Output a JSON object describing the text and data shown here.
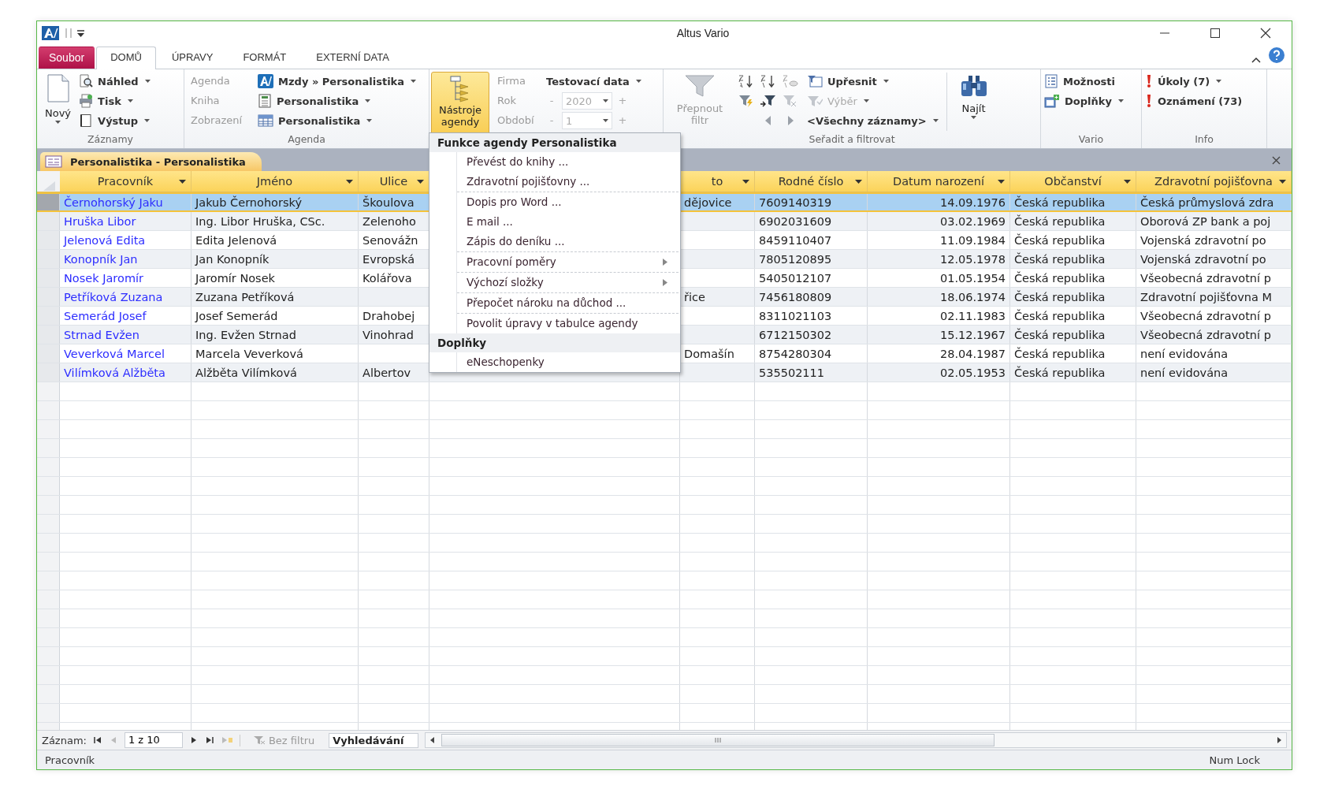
{
  "window": {
    "title": "Altus Vario"
  },
  "ribbon_tabs": [
    {
      "label": "Soubor",
      "kind": "file",
      "selected": false
    },
    {
      "label": "DOMŮ",
      "kind": "tab",
      "selected": true
    },
    {
      "label": "ÚPRAVY",
      "kind": "tab",
      "selected": false
    },
    {
      "label": "FORMÁT",
      "kind": "tab",
      "selected": false
    },
    {
      "label": "EXTERNÍ DATA",
      "kind": "tab",
      "selected": false
    }
  ],
  "ribbon": {
    "records": {
      "label": "Záznamy",
      "new_button": "Nový",
      "items": [
        "Náhled",
        "Tisk",
        "Výstup"
      ]
    },
    "agenda": {
      "label": "Agenda",
      "rows": [
        {
          "caption": "Agenda",
          "value": "Mzdy » Personalistika"
        },
        {
          "caption": "Kniha",
          "value": "Personalistika"
        },
        {
          "caption": "Zobrazení",
          "value": "Personalistika"
        }
      ]
    },
    "tools_button": {
      "label": "Nástroje agendy",
      "expanded": true
    },
    "period": {
      "rows": [
        {
          "caption": "Firma",
          "kind": "dropdown",
          "value": "Testovací data",
          "disabled": false
        },
        {
          "caption": "Rok",
          "kind": "spinner",
          "minus": "-",
          "value": "2020",
          "plus": "+",
          "disabled": true
        },
        {
          "caption": "Období",
          "kind": "spinner",
          "minus": "-",
          "value": "1",
          "plus": "+",
          "disabled": true
        }
      ]
    },
    "filter": {
      "label": "Seřadit a filtrovat",
      "toggle_button": "Přepnout filtr",
      "toggle_disabled": true,
      "refine": "Upřesnit",
      "selection": "Výběr",
      "selection_disabled": true,
      "records": "<Všechny záznamy>",
      "find": "Najít"
    },
    "vario": {
      "label": "Vario",
      "items": [
        "Možnosti",
        "Doplňky"
      ]
    },
    "info": {
      "label": "Info",
      "items": [
        "Úkoly (7)",
        "Oznámení (73)"
      ]
    }
  },
  "document_tab": {
    "title": "Personalistika - Personalistika"
  },
  "table": {
    "columns": [
      {
        "label": "Pracovník",
        "kind": "link"
      },
      {
        "label": "Jméno",
        "kind": "text"
      },
      {
        "label": "Ulice",
        "kind": "text"
      },
      {
        "label": "to",
        "kind": "text"
      },
      {
        "label": "Rodné číslo",
        "kind": "text"
      },
      {
        "label": "Datum narození",
        "kind": "date"
      },
      {
        "label": "Občanství",
        "kind": "text"
      },
      {
        "label": "Zdravotní pojišťovna",
        "kind": "text"
      }
    ],
    "rows": [
      {
        "selected": true,
        "cells": [
          "Černohorský Jaku",
          "Jakub Černohorský",
          "Škoulova",
          "dějovice",
          "7609140319",
          "14.09.1976",
          "Česká republika",
          "Česká průmyslová zdra"
        ]
      },
      {
        "selected": false,
        "cells": [
          "Hruška Libor",
          "Ing. Libor Hruška, CSc.",
          "Zelenoho",
          null,
          "6902031609",
          "03.02.1969",
          "Česká republika",
          "Oborová ZP bank a poj"
        ]
      },
      {
        "selected": false,
        "cells": [
          "Jelenová Edita",
          "Edita Jelenová",
          "Senovážn",
          null,
          "8459110407",
          "11.09.1984",
          "Česká republika",
          "Vojenská zdravotní po"
        ]
      },
      {
        "selected": false,
        "cells": [
          "Konopník Jan",
          "Jan Konopník",
          "Evropská",
          null,
          "7805120895",
          "12.05.1978",
          "Česká republika",
          "Vojenská zdravotní po"
        ]
      },
      {
        "selected": false,
        "cells": [
          "Nosek Jaromír",
          "Jaromír Nosek",
          "Kolářova",
          null,
          "5405012107",
          "01.05.1954",
          "Česká republika",
          "Všeobecná zdravotní p"
        ]
      },
      {
        "selected": false,
        "cells": [
          "Petříková Zuzana",
          "Zuzana Petříková",
          null,
          "řice",
          "7456180809",
          "18.06.1974",
          "Česká republika",
          "Zdravotní pojišťovna M"
        ]
      },
      {
        "selected": false,
        "cells": [
          "Semerád Josef",
          "Josef Semerád",
          "Drahobej",
          null,
          "8311021103",
          "02.11.1983",
          "Česká republika",
          "Všeobecná zdravotní p"
        ]
      },
      {
        "selected": false,
        "cells": [
          "Strnad Evžen",
          "Ing. Evžen Strnad",
          "Vinohrad",
          null,
          "6712150302",
          "15.12.1967",
          "Česká republika",
          "Všeobecná zdravotní p"
        ]
      },
      {
        "selected": false,
        "cells": [
          "Veverková Marcel",
          "Marcela Veverková",
          null,
          "Domašín",
          "8754280304",
          "28.04.1987",
          "Česká republika",
          "není evidována"
        ]
      },
      {
        "selected": false,
        "cells": [
          "Vilímková Alžběta",
          "Alžběta Vilímková",
          "Albertov",
          null,
          "535502111",
          "02.05.1953",
          "Česká republika",
          "není evidována"
        ]
      }
    ]
  },
  "menu": {
    "sections": [
      {
        "title": "Funkce agendy Personalistika",
        "groups": [
          {
            "items": [
              {
                "label": "Převést do knihy ...",
                "submenu": false
              },
              {
                "label": "Zdravotní pojišťovny ...",
                "submenu": false
              }
            ]
          },
          {
            "items": [
              {
                "label": "Dopis pro Word ...",
                "submenu": false
              },
              {
                "label": "E mail ...",
                "submenu": false
              },
              {
                "label": "Zápis do deníku ...",
                "submenu": false
              }
            ]
          },
          {
            "items": [
              {
                "label": "Pracovní poměry",
                "submenu": true
              }
            ]
          },
          {
            "items": [
              {
                "label": "Výchozí složky",
                "submenu": true
              }
            ]
          },
          {
            "items": [
              {
                "label": "Přepočet nároku na důchod ...",
                "submenu": false
              }
            ]
          },
          {
            "items": [
              {
                "label": "Povolit úpravy v tabulce agendy",
                "submenu": false
              }
            ]
          }
        ]
      },
      {
        "title": "Doplňky",
        "groups": [
          {
            "items": [
              {
                "label": "eNeschopenky",
                "submenu": false
              }
            ]
          }
        ]
      }
    ]
  },
  "record_nav": {
    "caption": "Záznam:",
    "position": "1 z 10",
    "filter": "Bez filtru",
    "filter_active": false,
    "search_placeholder": "Vyhledávání"
  },
  "status_bar": {
    "left": "Pracovník",
    "right": "Num Lock"
  }
}
